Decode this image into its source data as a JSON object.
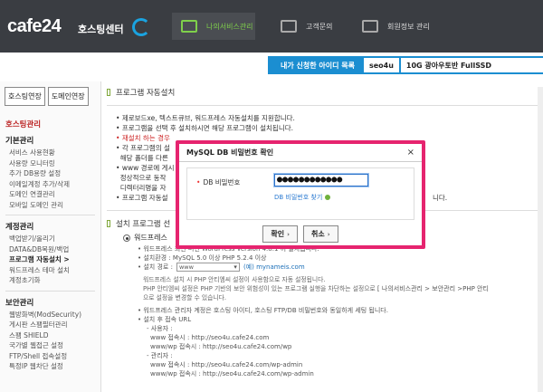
{
  "header": {
    "logo": "cafe24",
    "logo_sub": "호스팅센터",
    "nav": [
      {
        "label": "나의서비스관리",
        "icon": "monitor-gear-icon",
        "active": true
      },
      {
        "label": "고객문의",
        "icon": "chat-icon",
        "active": false
      },
      {
        "label": "회원정보 관리",
        "icon": "id-card-icon",
        "active": false
      }
    ]
  },
  "id_bar": {
    "label": "내가 신청한 아이디 목록",
    "id": "seo4u",
    "plan": "10G 광아우토반 FullSSD"
  },
  "sidebar": {
    "tabs": [
      "호스팅연장",
      "도메인연장"
    ],
    "title": "호스팅관리",
    "groups": [
      {
        "name": "기본관리",
        "items": [
          "서비스 사용현황",
          "사용량 모니터링",
          "추가 DB용량 설정",
          "이메일계정 추가/삭제",
          "도메인 연결관리",
          "모바일 도메인 관리"
        ]
      },
      {
        "name": "계정관리",
        "items": [
          "백업받기/올리기",
          "DATA&DB복원/백업",
          "프로그램 자동설치 >",
          "워드프레스 테마 설치",
          "계정초기화"
        ]
      },
      {
        "name": "보안관리",
        "items": [
          "웹방화벽(ModSecurity)",
          "게시판 스팸필터관리",
          "스팸 SHIELD",
          "국가별 웹접근 설정",
          "FTP/Shell 접속설정",
          "특정IP 웹차단 설정"
        ]
      }
    ],
    "current_item": "프로그램 자동설치 >"
  },
  "main": {
    "title": "프로그램 자동설치",
    "intro": [
      "제로보드xe, 텍스트큐브, 워드프레스 자동설치를 지원합니다.",
      "프로그램을 선택 후 설치하시면 해당 프로그램이 설치됩니다.",
      "재설치 하는 경우",
      "각 프로그램의 설",
      "해당 폴더를 다른",
      "www 경로에 게시",
      "정상적으로 동작",
      "디렉터리명을 자",
      "프로그램 자동설"
    ],
    "intro_tail": "니다.",
    "section2_title": "설치 프로그램 선",
    "program": "워드프레스",
    "details": [
      "워드프레스 최신 버전 WordPress Version 4.8.1 이 설치됩니다.",
      "설치환경 : MySQL 5.0 이상 PHP 5.2.4 이상"
    ],
    "path_label": "설치 경로 :",
    "path_value": "www",
    "path_url": "(예) mynameis.com",
    "note": [
      "워드프레스 설치 시 PHP 안티엠씨 설정이 사용함으로 자동 설정됩니다.",
      "PHP 안티엠씨 설정은 PHP 기반의 보안 위험성이 있는 프로그램 실행을 차단하는 설정으로",
      "으로 설정을 변경할 수 있습니다."
    ],
    "note_link": "[ 나의서비스관리 > 보안관리 >PHP 안티",
    "after": [
      "워드프레스 관리자 계정은 호스팅 아이디, 호스팅 FTP/DB 비밀번호와 동일하게 세팅 됩니다.",
      "설치 후 접속 URL"
    ],
    "urls": {
      "user_label": "- 사용자 :",
      "user_www": "www 접속시 : http://seo4u.cafe24.com",
      "user_wp": "www/wp 접속시 : http://seo4u.cafe24.com/wp",
      "admin_label": "- 관리자 :",
      "admin_www": "www 접속시 : http://seo4u.cafe24.com/wp-admin",
      "admin_wp": "www/wp 접속시 : http://seo4u.cafe24.com/wp-admin"
    }
  },
  "dialog": {
    "title": "MySQL DB 비밀번호 확인",
    "close": "×",
    "field_label": "DB 비밀번호",
    "password_mask": "●●●●●●●●●●●●",
    "forgot": "DB 비밀번호 찾기",
    "ok": "확인",
    "cancel": "취소"
  }
}
